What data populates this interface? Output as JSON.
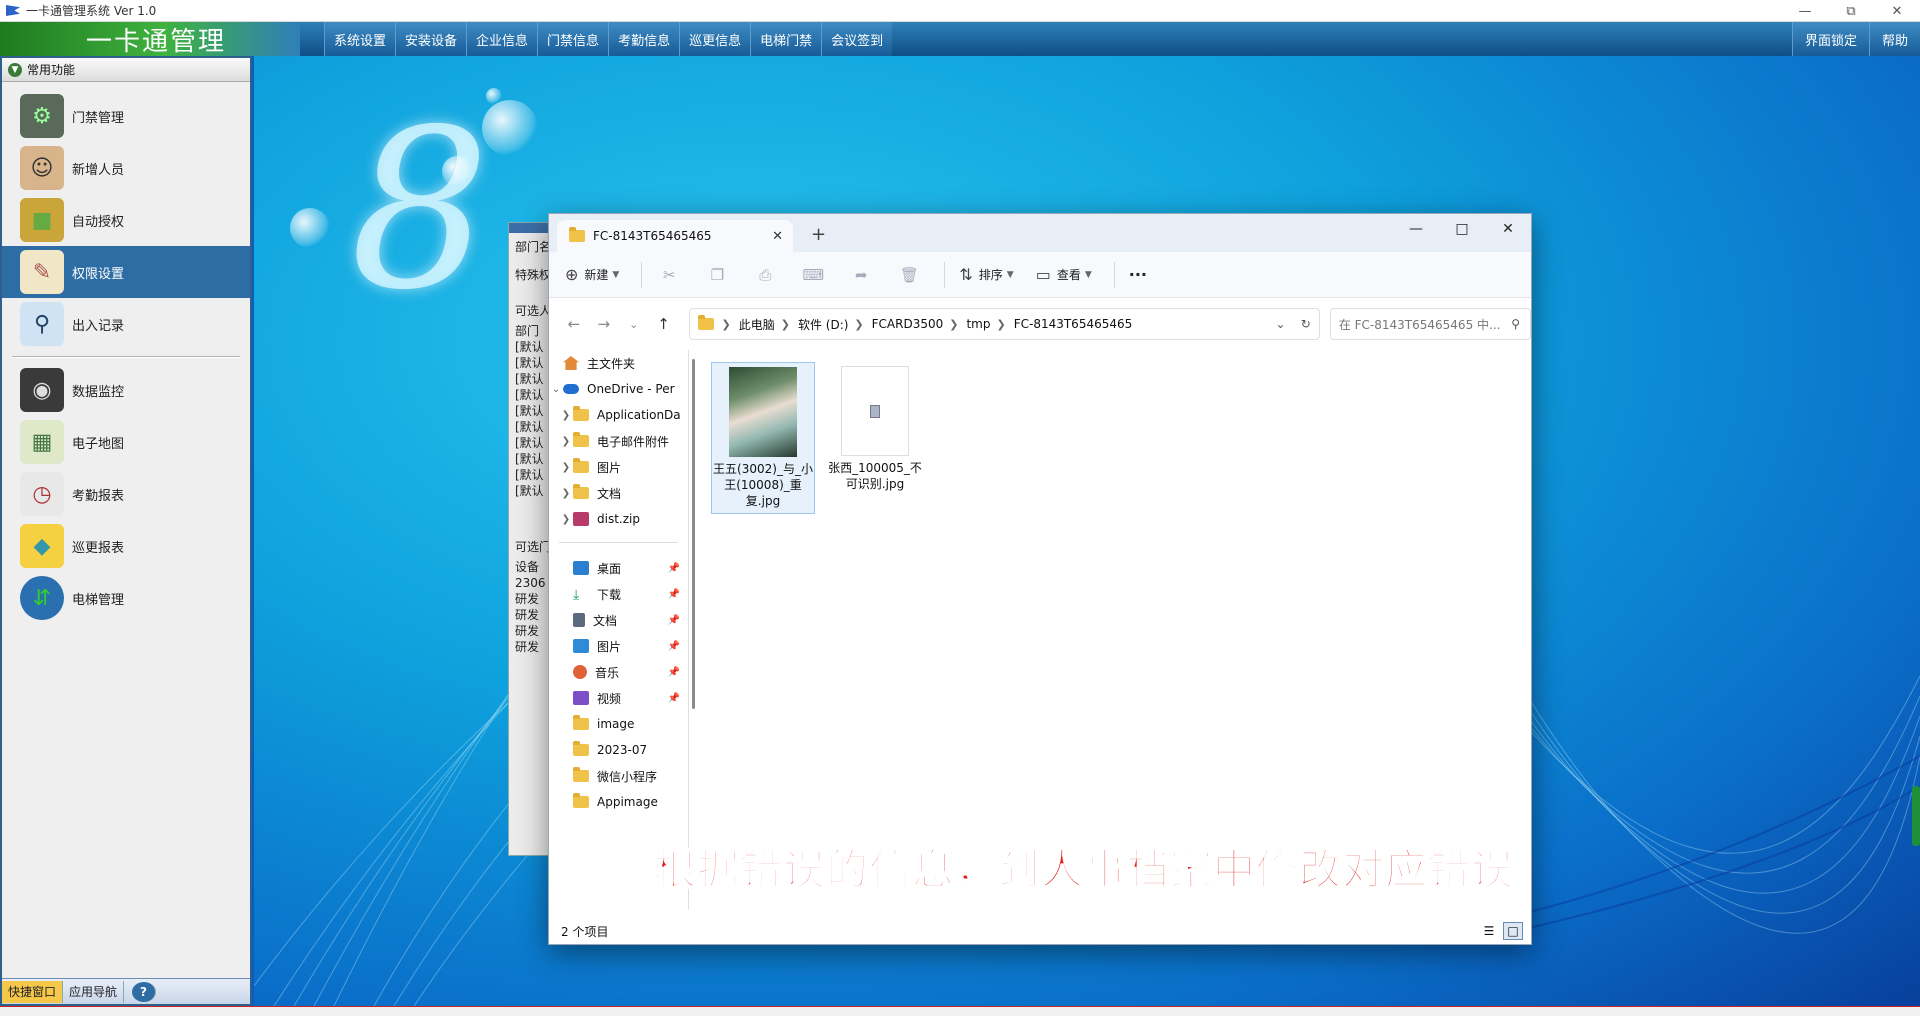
{
  "app": {
    "window_title": "一卡通管理系统  Ver 1.0",
    "brand": "一卡通管理",
    "menus": [
      "系统设置",
      "安装设备",
      "企业信息",
      "门禁信息",
      "考勤信息",
      "巡更信息",
      "电梯门禁",
      "会议签到"
    ],
    "menus_right": [
      "界面锁定",
      "帮助"
    ]
  },
  "sidebar": {
    "header": "常用功能",
    "items_top": [
      {
        "label": "门禁管理",
        "icon": "access-control-icon"
      },
      {
        "label": "新增人员",
        "icon": "person-icon"
      },
      {
        "label": "自动授权",
        "icon": "card-icon"
      },
      {
        "label": "权限设置",
        "icon": "document-icon"
      },
      {
        "label": "出入记录",
        "icon": "magnifier-icon"
      }
    ],
    "items_bottom": [
      {
        "label": "数据监控",
        "icon": "camera-icon"
      },
      {
        "label": "电子地图",
        "icon": "map-icon"
      },
      {
        "label": "考勤报表",
        "icon": "clock-icon"
      },
      {
        "label": "巡更报表",
        "icon": "patrol-icon"
      },
      {
        "label": "电梯管理",
        "icon": "elevator-icon"
      }
    ],
    "active_item": "权限设置",
    "tabs": [
      "快捷窗口",
      "应用导航"
    ]
  },
  "bg_window": {
    "lines": [
      "部门名",
      "特殊权",
      "可选人",
      "部门",
      "[默认",
      "[默认",
      "[默认",
      "[默认",
      "[默认",
      "[默认",
      "[默认",
      "[默认",
      "[默认",
      "[默认",
      "可选门",
      "设备",
      "2306",
      "研发",
      "研发",
      "研发",
      "研发"
    ]
  },
  "explorer": {
    "tab_title": "FC-8143T65465465",
    "toolbar": {
      "new": "新建",
      "sort": "排序",
      "view": "查看",
      "more": "···"
    },
    "breadcrumb": [
      "此电脑",
      "软件 (D:)",
      "FCARD3500",
      "tmp",
      "FC-8143T65465465"
    ],
    "search_placeholder": "在 FC-8143T65465465 中...",
    "nav": {
      "home": "主文件夹",
      "onedrive": "OneDrive - Per",
      "od_children": [
        "ApplicationDa",
        "电子邮件附件",
        "图片",
        "文档",
        "dist.zip"
      ],
      "quick": [
        {
          "label": "桌面",
          "icon": "desktop-icon",
          "color": "#2a7fd0",
          "pinned": true
        },
        {
          "label": "下载",
          "icon": "download-icon",
          "color": "#1a9a5a",
          "pinned": true
        },
        {
          "label": "文档",
          "icon": "documents-icon",
          "color": "#5a6b80",
          "pinned": true
        },
        {
          "label": "图片",
          "icon": "pictures-icon",
          "color": "#2f8ad8",
          "pinned": true
        },
        {
          "label": "音乐",
          "icon": "music-icon",
          "color": "#e0603a",
          "pinned": true
        },
        {
          "label": "视频",
          "icon": "videos-icon",
          "color": "#7a4fc8",
          "pinned": true
        },
        {
          "label": "image",
          "icon": "folder-icon",
          "color": "#f1c24a",
          "pinned": false
        },
        {
          "label": "2023-07",
          "icon": "folder-icon",
          "color": "#f1c24a",
          "pinned": false
        },
        {
          "label": "微信小程序",
          "icon": "folder-icon",
          "color": "#f1c24a",
          "pinned": false
        },
        {
          "label": "Appimage",
          "icon": "folder-icon",
          "color": "#f1c24a",
          "pinned": false
        }
      ]
    },
    "files": [
      {
        "name": "王五(3002)_与_小王(10008)_重复.jpg",
        "kind": "photo",
        "selected": true
      },
      {
        "name": "张西_100005_不可识别.jpg",
        "kind": "doc",
        "selected": false
      }
    ],
    "status": "2 个项目"
  },
  "caption": "根据错误的信息，到人事档案中修改对应错误",
  "colors": {
    "accent": "#2e6da4",
    "caption": "#e01e1e",
    "brand_green": "#3fb23f"
  }
}
